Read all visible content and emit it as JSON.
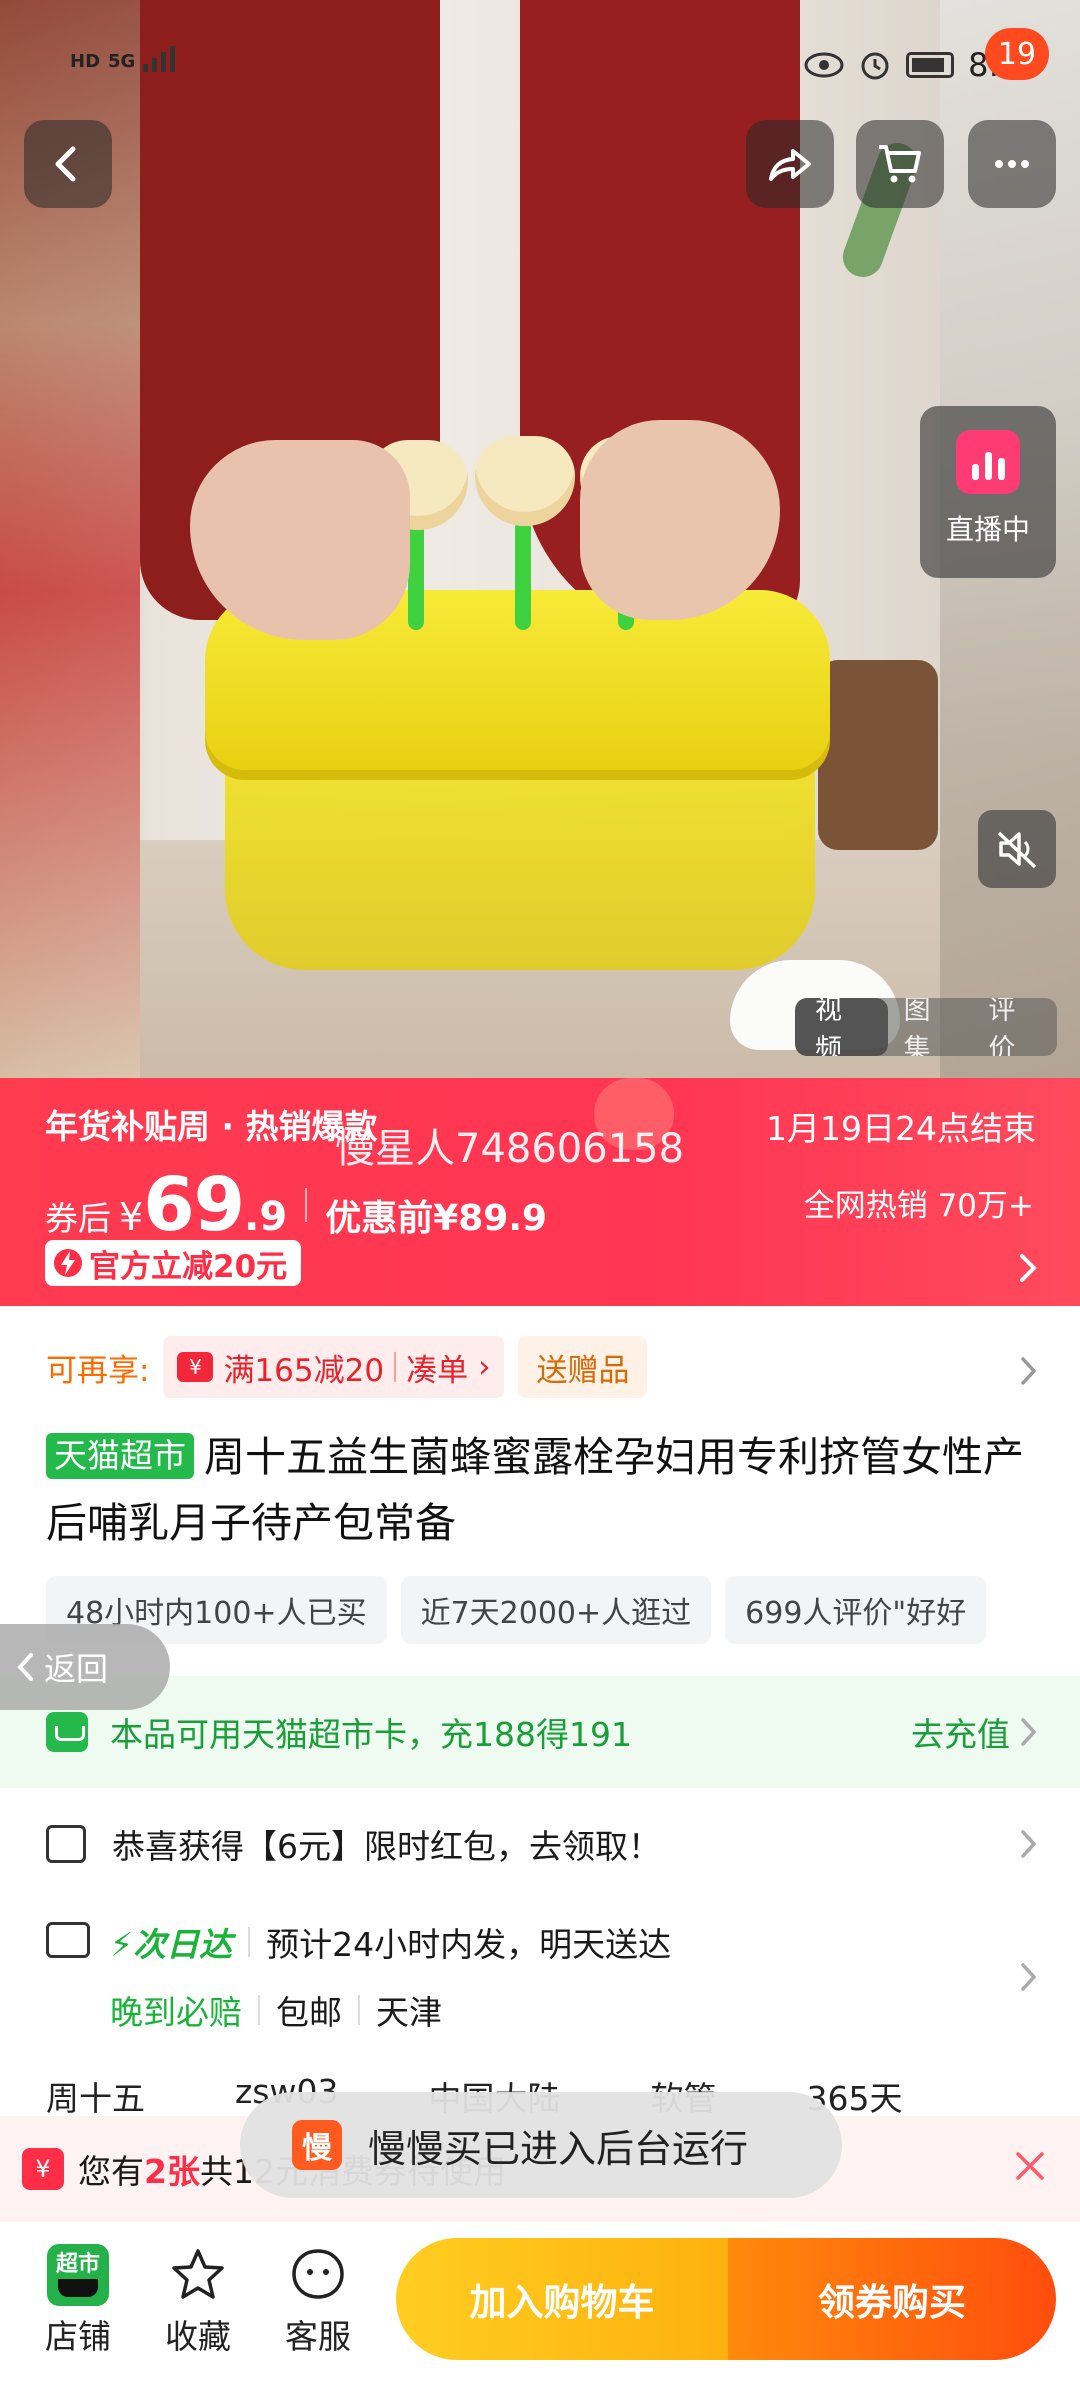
{
  "status_bar": {
    "network_left": "HD",
    "network_5g": "5G",
    "time": "8:12"
  },
  "top_bar": {
    "cart_badge": "19"
  },
  "hero": {
    "live_label": "直播中",
    "media_tabs": [
      "视频",
      "图集",
      "评价"
    ]
  },
  "promo": {
    "title": "年货补贴周 · 热销爆款",
    "end_time": "1月19日24点结束",
    "watermark": "慢星人748606158",
    "after_label": "券后",
    "currency": "¥",
    "price_int": "69",
    "price_dec": ".9",
    "before_price": "优惠前¥89.9",
    "hot_sale": "全网热销 70万+",
    "official_cut": "官方立减20元"
  },
  "offers": {
    "label": "可再享:",
    "coupon": "满165减20",
    "coupon_action": "凑单",
    "gift": "送赠品"
  },
  "product": {
    "store_tag": "天猫超市",
    "title": "周十五益生菌蜂蜜露栓孕妇用专利挤管女性产后哺乳月子待产包常备"
  },
  "chips": [
    "48小时内100+人已买",
    "近7天2000+人逛过",
    "699人评价\"好好"
  ],
  "back_label": "返回",
  "tmall_card": {
    "text": "本品可用天猫超市卡，充188得191",
    "action": "去充值"
  },
  "red_packet": {
    "text": "恭喜获得【6元】限时红包，去领取！"
  },
  "delivery": {
    "fast_label": "次日达",
    "estimate": "预计24小时内发，明天送达",
    "late_compensation": "晚到必赔",
    "free_shipping": "包邮",
    "ship_from": "天津"
  },
  "specs": [
    "周十五",
    "zsw03",
    "中国大陆",
    "软管",
    "365天"
  ],
  "toast": {
    "app_icon_char": "慢",
    "text": "慢慢买已进入后台运行"
  },
  "coupon_bar": {
    "prefix": "您有",
    "count": "2张",
    "suffix": "共12元消费券待使用"
  },
  "bottom_bar": {
    "shop_icon_text": "超市",
    "shop": "店铺",
    "favorite": "收藏",
    "service": "客服",
    "add_to_cart": "加入购物车",
    "buy": "领券购买"
  },
  "colors": {
    "promo_red": "#ff3b50",
    "tmall_green": "#23b94b",
    "cart_yellow": "#ffb10e",
    "buy_orange": "#ff4d0d"
  }
}
